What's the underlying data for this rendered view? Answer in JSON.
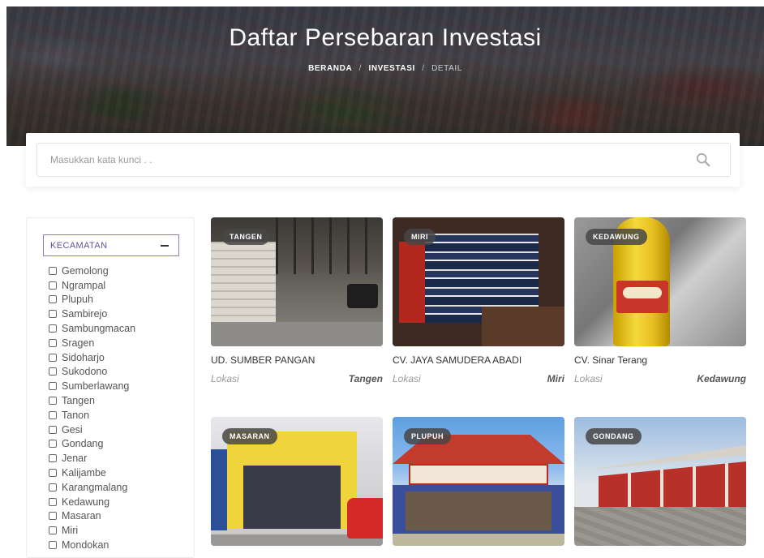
{
  "hero": {
    "title": "Daftar Persebaran Investasi",
    "breadcrumb": [
      "BERANDA",
      "INVESTASI",
      "DETAIL"
    ],
    "separator": "/"
  },
  "search": {
    "placeholder": "Masukkan kata kunci . ."
  },
  "filter": {
    "title": "KECAMATAN",
    "options": [
      "Gemolong",
      "Ngrampal",
      "Plupuh",
      "Sambirejo",
      "Sambungmacan",
      "Sragen",
      "Sidoharjo",
      "Sukodono",
      "Sumberlawang",
      "Tangen",
      "Tanon",
      "Gesi",
      "Gondang",
      "Jenar",
      "Kalijambe",
      "Karangmalang",
      "Kedawung",
      "Masaran",
      "Miri",
      "Mondokan"
    ]
  },
  "cards": [
    {
      "badge": "TANGEN",
      "name": "UD. SUMBER PANGAN",
      "location_label": "Lokasi",
      "location": "Tangen"
    },
    {
      "badge": "MIRI",
      "name": "CV. JAYA SAMUDERA ABADI",
      "location_label": "Lokasi",
      "location": "Miri"
    },
    {
      "badge": "KEDAWUNG",
      "name": "CV. Sinar Terang",
      "location_label": "Lokasi",
      "location": "Kedawung"
    },
    {
      "badge": "MASARAN"
    },
    {
      "badge": "PLUPUH"
    },
    {
      "badge": "GONDANG"
    }
  ],
  "colors": {
    "accent": "#5b53a5",
    "badge_bg": "#464646"
  }
}
